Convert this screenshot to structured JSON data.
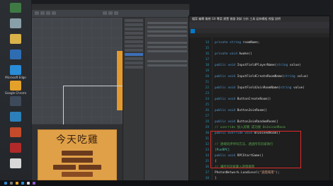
{
  "desktop_icons": [
    {
      "label": "",
      "icon": "app-icon",
      "color": "#3f7a45"
    },
    {
      "label": "",
      "icon": "recycle-bin-icon",
      "color": "#8aa0a8"
    },
    {
      "label": "",
      "icon": "folder-icon",
      "color": "#d9b24a"
    },
    {
      "label": "",
      "icon": "app-icon",
      "color": "#2f6db3"
    },
    {
      "label": "Microsoft Edge",
      "icon": "edge-icon",
      "color": "#2a8bd6"
    },
    {
      "label": "Google Chrome",
      "icon": "chrome-icon",
      "color": "#e4a12a"
    },
    {
      "label": "",
      "icon": "app-icon",
      "color": "#3c4a5a"
    },
    {
      "label": "",
      "icon": "app-icon",
      "color": "#2c7fb8"
    },
    {
      "label": "",
      "icon": "app-icon",
      "color": "#c34a2a"
    },
    {
      "label": "",
      "icon": "app-icon",
      "color": "#b02a2a"
    },
    {
      "label": "",
      "icon": "unity-icon",
      "color": "#d8d8d8"
    }
  ],
  "unity": {
    "game_title": "今天吃雞",
    "menu_buttons": [
      "",
      "",
      "",
      ""
    ]
  },
  "vs": {
    "menu": "檔案  編輯  檢視  Git  專案  建置  偵錯  測試  分析  工具  延伸模組  視窗  說明",
    "active_tab": "",
    "code_lines": [
      {
        "n": "14",
        "tokens": [
          [
            "kw",
            "private string "
          ],
          [
            "df",
            "roomName;"
          ]
        ]
      },
      {
        "n": "15",
        "tokens": []
      },
      {
        "n": "16",
        "tokens": [
          [
            "kw",
            "private void "
          ],
          [
            "df",
            "Awake()"
          ]
        ]
      },
      {
        "n": "17",
        "tokens": []
      },
      {
        "n": "18",
        "tokens": [
          [
            "kw",
            "public void "
          ],
          [
            "df",
            "InputFieldPlayerName("
          ],
          [
            "kw",
            "string "
          ],
          [
            "df",
            "value)"
          ]
        ]
      },
      {
        "n": "19",
        "tokens": []
      },
      {
        "n": "20",
        "tokens": [
          [
            "kw",
            "public void "
          ],
          [
            "df",
            "InputFieldCreateRoomName("
          ],
          [
            "kw",
            "string "
          ],
          [
            "df",
            "value)"
          ]
        ]
      },
      {
        "n": "21",
        "tokens": []
      },
      {
        "n": "22",
        "tokens": [
          [
            "kw",
            "public void "
          ],
          [
            "df",
            "InputFieldJoinRoomName("
          ],
          [
            "kw",
            "string "
          ],
          [
            "df",
            "value)"
          ]
        ]
      },
      {
        "n": "23",
        "tokens": []
      },
      {
        "n": "24",
        "tokens": [
          [
            "kw",
            "public void "
          ],
          [
            "df",
            "ButtonCreateRoom()"
          ]
        ]
      },
      {
        "n": "25",
        "tokens": []
      },
      {
        "n": "26",
        "tokens": [
          [
            "kw",
            "public void "
          ],
          [
            "df",
            "ButtonJoinRoom()"
          ]
        ]
      },
      {
        "n": "27",
        "tokens": []
      },
      {
        "n": "28",
        "tokens": [
          [
            "kw",
            "public void "
          ],
          [
            "df",
            "ButtonJoinRandomRoom()"
          ]
        ]
      },
      {
        "n": "29",
        "tokens": [
          [
            "cm",
            "// override 加入房間 成功後 OnJoinedRoom"
          ]
        ]
      },
      {
        "n": "30",
        "tokens": [
          [
            "kw",
            "public override void "
          ],
          [
            "df",
            "OnJoinedRoom()"
          ]
        ]
      },
      {
        "n": "31",
        "tokens": []
      },
      {
        "n": "32",
        "tokens": [
          [
            "cm",
            "// 遠端同步呼叫方法，透過所有玩家執行"
          ]
        ]
      },
      {
        "n": "33",
        "tokens": [
          [
            "ty",
            "[PunRPC]"
          ]
        ]
      },
      {
        "n": "34",
        "tokens": [
          [
            "kw",
            "public void "
          ],
          [
            "df",
            "RPCStartGame()"
          ]
        ]
      },
      {
        "n": "35",
        "tokens": [
          [
            "df",
            "{"
          ]
        ]
      },
      {
        "n": "36",
        "tokens": [
          [
            "cm",
            "    // 讓所有玩家載入遊戲場景"
          ]
        ]
      },
      {
        "n": "37",
        "tokens": [
          [
            "df",
            "    PhotonNetwork.LoadLevel("
          ],
          [
            "st",
            "\"遊戲場景\""
          ],
          [
            "df",
            ");"
          ]
        ]
      },
      {
        "n": "38",
        "tokens": [
          [
            "df",
            "}"
          ]
        ]
      }
    ]
  },
  "taskbar": {
    "clock": ""
  }
}
